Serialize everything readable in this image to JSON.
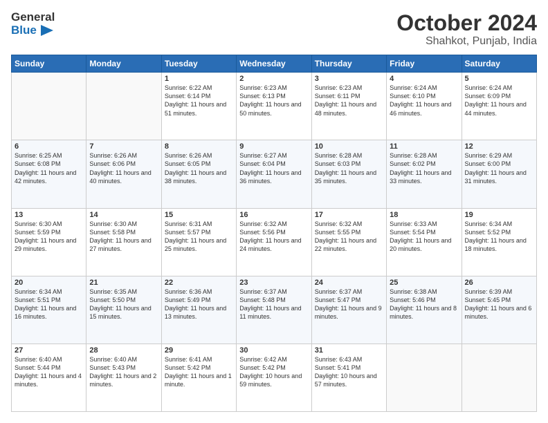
{
  "logo": {
    "line1": "General",
    "line2": "Blue"
  },
  "header": {
    "month": "October 2024",
    "location": "Shahkot, Punjab, India"
  },
  "weekdays": [
    "Sunday",
    "Monday",
    "Tuesday",
    "Wednesday",
    "Thursday",
    "Friday",
    "Saturday"
  ],
  "weeks": [
    [
      {
        "day": "",
        "text": ""
      },
      {
        "day": "",
        "text": ""
      },
      {
        "day": "1",
        "text": "Sunrise: 6:22 AM\nSunset: 6:14 PM\nDaylight: 11 hours and 51 minutes."
      },
      {
        "day": "2",
        "text": "Sunrise: 6:23 AM\nSunset: 6:13 PM\nDaylight: 11 hours and 50 minutes."
      },
      {
        "day": "3",
        "text": "Sunrise: 6:23 AM\nSunset: 6:11 PM\nDaylight: 11 hours and 48 minutes."
      },
      {
        "day": "4",
        "text": "Sunrise: 6:24 AM\nSunset: 6:10 PM\nDaylight: 11 hours and 46 minutes."
      },
      {
        "day": "5",
        "text": "Sunrise: 6:24 AM\nSunset: 6:09 PM\nDaylight: 11 hours and 44 minutes."
      }
    ],
    [
      {
        "day": "6",
        "text": "Sunrise: 6:25 AM\nSunset: 6:08 PM\nDaylight: 11 hours and 42 minutes."
      },
      {
        "day": "7",
        "text": "Sunrise: 6:26 AM\nSunset: 6:06 PM\nDaylight: 11 hours and 40 minutes."
      },
      {
        "day": "8",
        "text": "Sunrise: 6:26 AM\nSunset: 6:05 PM\nDaylight: 11 hours and 38 minutes."
      },
      {
        "day": "9",
        "text": "Sunrise: 6:27 AM\nSunset: 6:04 PM\nDaylight: 11 hours and 36 minutes."
      },
      {
        "day": "10",
        "text": "Sunrise: 6:28 AM\nSunset: 6:03 PM\nDaylight: 11 hours and 35 minutes."
      },
      {
        "day": "11",
        "text": "Sunrise: 6:28 AM\nSunset: 6:02 PM\nDaylight: 11 hours and 33 minutes."
      },
      {
        "day": "12",
        "text": "Sunrise: 6:29 AM\nSunset: 6:00 PM\nDaylight: 11 hours and 31 minutes."
      }
    ],
    [
      {
        "day": "13",
        "text": "Sunrise: 6:30 AM\nSunset: 5:59 PM\nDaylight: 11 hours and 29 minutes."
      },
      {
        "day": "14",
        "text": "Sunrise: 6:30 AM\nSunset: 5:58 PM\nDaylight: 11 hours and 27 minutes."
      },
      {
        "day": "15",
        "text": "Sunrise: 6:31 AM\nSunset: 5:57 PM\nDaylight: 11 hours and 25 minutes."
      },
      {
        "day": "16",
        "text": "Sunrise: 6:32 AM\nSunset: 5:56 PM\nDaylight: 11 hours and 24 minutes."
      },
      {
        "day": "17",
        "text": "Sunrise: 6:32 AM\nSunset: 5:55 PM\nDaylight: 11 hours and 22 minutes."
      },
      {
        "day": "18",
        "text": "Sunrise: 6:33 AM\nSunset: 5:54 PM\nDaylight: 11 hours and 20 minutes."
      },
      {
        "day": "19",
        "text": "Sunrise: 6:34 AM\nSunset: 5:52 PM\nDaylight: 11 hours and 18 minutes."
      }
    ],
    [
      {
        "day": "20",
        "text": "Sunrise: 6:34 AM\nSunset: 5:51 PM\nDaylight: 11 hours and 16 minutes."
      },
      {
        "day": "21",
        "text": "Sunrise: 6:35 AM\nSunset: 5:50 PM\nDaylight: 11 hours and 15 minutes."
      },
      {
        "day": "22",
        "text": "Sunrise: 6:36 AM\nSunset: 5:49 PM\nDaylight: 11 hours and 13 minutes."
      },
      {
        "day": "23",
        "text": "Sunrise: 6:37 AM\nSunset: 5:48 PM\nDaylight: 11 hours and 11 minutes."
      },
      {
        "day": "24",
        "text": "Sunrise: 6:37 AM\nSunset: 5:47 PM\nDaylight: 11 hours and 9 minutes."
      },
      {
        "day": "25",
        "text": "Sunrise: 6:38 AM\nSunset: 5:46 PM\nDaylight: 11 hours and 8 minutes."
      },
      {
        "day": "26",
        "text": "Sunrise: 6:39 AM\nSunset: 5:45 PM\nDaylight: 11 hours and 6 minutes."
      }
    ],
    [
      {
        "day": "27",
        "text": "Sunrise: 6:40 AM\nSunset: 5:44 PM\nDaylight: 11 hours and 4 minutes."
      },
      {
        "day": "28",
        "text": "Sunrise: 6:40 AM\nSunset: 5:43 PM\nDaylight: 11 hours and 2 minutes."
      },
      {
        "day": "29",
        "text": "Sunrise: 6:41 AM\nSunset: 5:42 PM\nDaylight: 11 hours and 1 minute."
      },
      {
        "day": "30",
        "text": "Sunrise: 6:42 AM\nSunset: 5:42 PM\nDaylight: 10 hours and 59 minutes."
      },
      {
        "day": "31",
        "text": "Sunrise: 6:43 AM\nSunset: 5:41 PM\nDaylight: 10 hours and 57 minutes."
      },
      {
        "day": "",
        "text": ""
      },
      {
        "day": "",
        "text": ""
      }
    ]
  ]
}
